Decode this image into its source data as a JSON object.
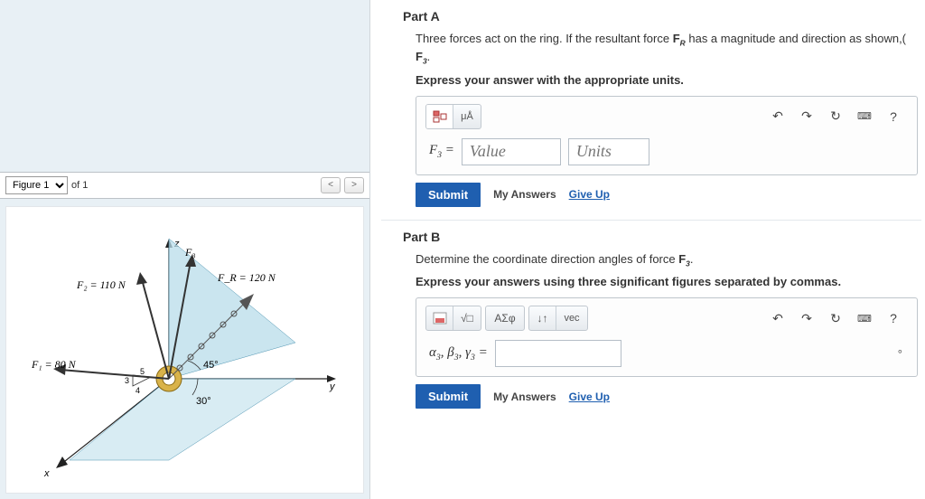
{
  "figure": {
    "selector_label": "Figure 1",
    "count_label": "of 1",
    "labels": {
      "F1": "F₁ = 80 N",
      "F2": "F₂ = 110 N",
      "FR": "F_R = 120 N",
      "F3": "F₃",
      "ang45": "45°",
      "ang30": "30°",
      "tri3": "3",
      "tri4": "4",
      "tri5": "5",
      "x": "x",
      "y": "y",
      "z": "z"
    }
  },
  "partA": {
    "title": "Part A",
    "prompt_prefix": "Three forces act on the ring. If the resultant force ",
    "prompt_FR": "F",
    "prompt_FR_sub": "R",
    "prompt_mid": " has a magnitude and direction as shown,(",
    "prompt_F3": "F",
    "prompt_F3_sub": "3",
    "prompt_suffix": ".",
    "express": "Express your answer with the appropriate units.",
    "var_label": "F₃ =",
    "value_placeholder": "Value",
    "units_placeholder": "Units",
    "submit": "Submit",
    "my_answers": "My Answers",
    "give_up": "Give Up",
    "tool_mu": "μÅ",
    "help": "?"
  },
  "partB": {
    "title": "Part B",
    "prompt_prefix": "Determine the coordinate direction angles of force ",
    "prompt_F3": "F",
    "prompt_F3_sub": "3",
    "prompt_suffix": ".",
    "express": "Express your answers using three significant figures separated by commas.",
    "var_label": "α₃, β₃, γ₃ =",
    "tool_greek": "ΑΣφ",
    "tool_vec": "vec",
    "tool_arrows": "↓↑",
    "deg": "°",
    "submit": "Submit",
    "my_answers": "My Answers",
    "give_up": "Give Up",
    "help": "?"
  }
}
